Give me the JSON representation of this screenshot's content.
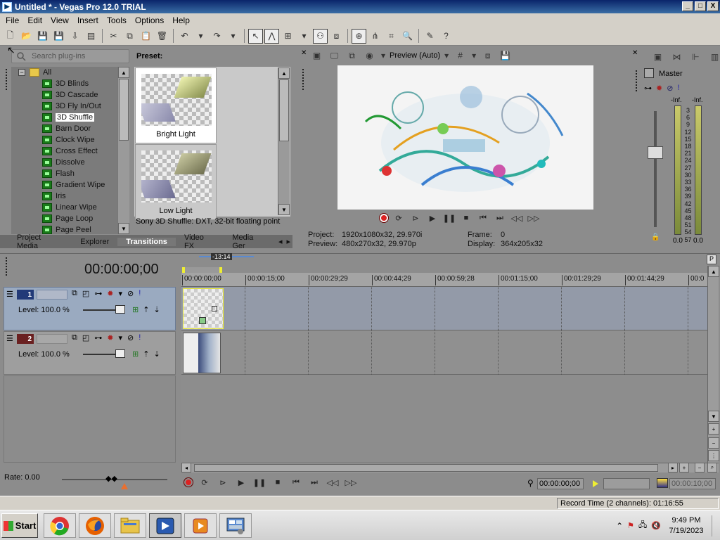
{
  "window": {
    "title": "Untitled * - Vegas Pro 12.0 TRIAL",
    "min": "_",
    "max": "□",
    "close": "X"
  },
  "menu": [
    "File",
    "Edit",
    "View",
    "Insert",
    "Tools",
    "Options",
    "Help"
  ],
  "explorer": {
    "search_placeholder": "Search plug-ins",
    "root": "All",
    "items": [
      "3D Blinds",
      "3D Cascade",
      "3D Fly In/Out",
      "3D Shuffle",
      "Barn Door",
      "Clock Wipe",
      "Cross Effect",
      "Dissolve",
      "Flash",
      "Gradient Wipe",
      "Iris",
      "Linear Wipe",
      "Page Loop",
      "Page Peel"
    ],
    "selected": "3D Shuffle",
    "preset_label": "Preset:",
    "presets": [
      "Bright Light",
      "Low Light"
    ],
    "description": "Sony 3D Shuffle: DXT, 32-bit floating point",
    "tabs": [
      "Project Media",
      "Explorer",
      "Transitions",
      "Video FX",
      "Media Ger"
    ],
    "active_tab": "Transitions"
  },
  "preview": {
    "mode": "Preview (Auto)",
    "project_label": "Project:",
    "project_value": "1920x1080x32, 29.970i",
    "preview_label": "Preview:",
    "preview_value": "480x270x32, 29.970p",
    "frame_label": "Frame:",
    "frame_value": "0",
    "display_label": "Display:",
    "display_value": "364x205x32"
  },
  "mixer": {
    "title": "Master",
    "inf_left": "-Inf.",
    "inf_right": "-Inf.",
    "scale": [
      "3",
      "6",
      "9",
      "12",
      "15",
      "18",
      "21",
      "24",
      "27",
      "30",
      "33",
      "36",
      "39",
      "42",
      "45",
      "48",
      "51",
      "54",
      "57"
    ],
    "val_left": "0.0",
    "val_right": "0.0"
  },
  "timeline": {
    "timecode": "00:00:00;00",
    "cursor_label": "-13:14",
    "ruler": [
      "00:00:00;00",
      "00:00:15;00",
      "00:00:29;29",
      "00:00:44;29",
      "00:00:59;28",
      "00:01:15;00",
      "00:01:29;29",
      "00:01:44;29",
      "00:0"
    ],
    "tracks": [
      {
        "num": "1",
        "level": "Level: 100.0 %"
      },
      {
        "num": "2",
        "level": "Level: 100.0 %"
      }
    ],
    "rate": "Rate: 0.00",
    "transport_time": "00:00:00;00",
    "end_time": "00:00:10;00"
  },
  "status": {
    "record_time": "Record Time (2 channels): 01:16:55"
  },
  "taskbar": {
    "start": "Start",
    "time": "9:49 PM",
    "date": "7/19/2023"
  }
}
